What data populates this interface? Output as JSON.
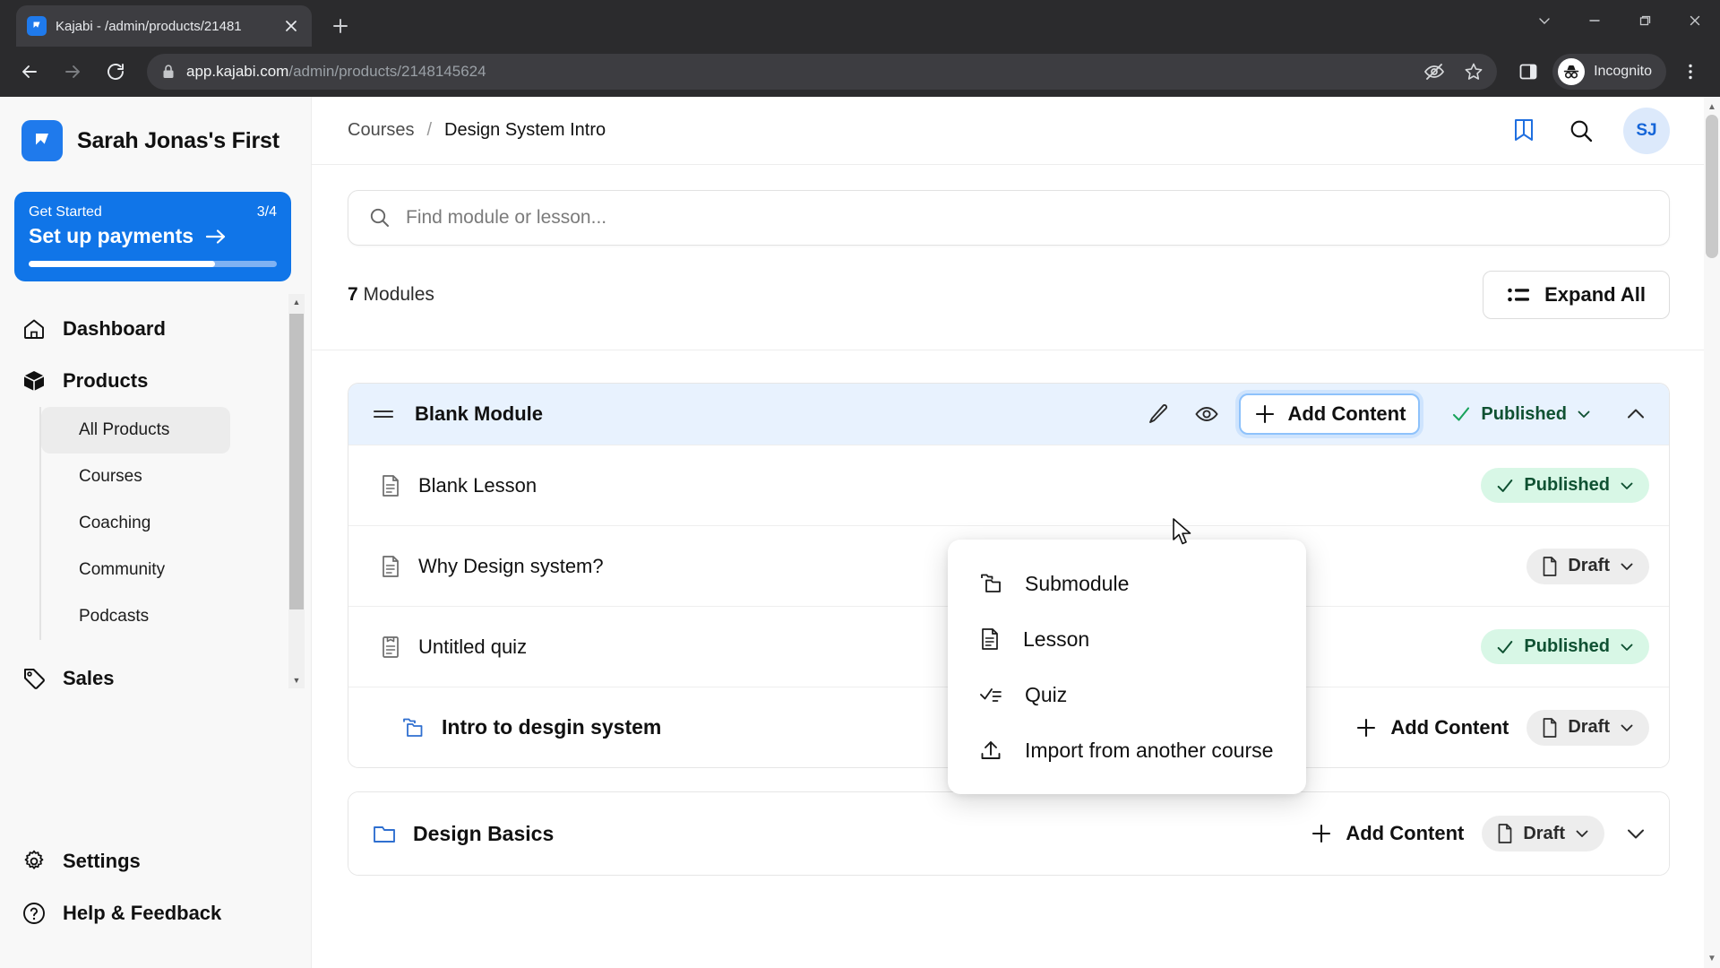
{
  "browser": {
    "tab": {
      "title": "Kajabi - /admin/products/21481",
      "favicon": "kajabi-logo-icon"
    },
    "new_tab_label": "+",
    "url_bold": "app.kajabi.com",
    "url_path": "/admin/products/2148145624",
    "profile_label": "Incognito",
    "window_controls": [
      "minimize-to-tray",
      "minimize",
      "maximize",
      "close"
    ]
  },
  "sidebar": {
    "brand": "Sarah Jonas's First",
    "get_started": {
      "label": "Get Started",
      "progress_label": "3/4",
      "cta": "Set up payments",
      "progress_percent": 75
    },
    "items": [
      {
        "label": "Dashboard",
        "icon": "home-icon"
      },
      {
        "label": "Products",
        "icon": "box-icon"
      },
      {
        "label": "Sales",
        "icon": "tag-icon"
      },
      {
        "label": "Settings",
        "icon": "gear-icon"
      },
      {
        "label": "Help & Feedback",
        "icon": "question-circle-icon"
      }
    ],
    "product_subitems": [
      {
        "label": "All Products",
        "active": true
      },
      {
        "label": "Courses",
        "active": false
      },
      {
        "label": "Coaching",
        "active": false
      },
      {
        "label": "Community",
        "active": false
      },
      {
        "label": "Podcasts",
        "active": false
      }
    ]
  },
  "header": {
    "breadcrumb": {
      "parent": "Courses",
      "separator": "/",
      "current": "Design System Intro"
    },
    "avatar_initials": "SJ"
  },
  "main": {
    "search_placeholder": "Find module or lesson...",
    "module_count_number": "7",
    "module_count_label": "Modules",
    "expand_all_label": "Expand All"
  },
  "module": {
    "title": "Blank Module",
    "add_content_label": "Add Content",
    "status": "Published",
    "rows": [
      {
        "title": "Blank Lesson",
        "icon": "document-icon",
        "status": "Published",
        "status_kind": "published",
        "add_content": false
      },
      {
        "title": "Why Design system?",
        "icon": "document-icon",
        "status": "Draft",
        "status_kind": "draft",
        "add_content": false
      },
      {
        "title": "Untitled quiz",
        "icon": "quiz-document-icon",
        "status": "Published",
        "status_kind": "published",
        "add_content": false
      },
      {
        "title": "Intro to desgin system",
        "icon": "submodule-icon",
        "status": "Draft",
        "status_kind": "draft",
        "add_content": true,
        "add_content_label": "Add Content",
        "submodule": true
      }
    ]
  },
  "module2": {
    "title": "Design Basics",
    "icon": "folder-icon",
    "add_content_label": "Add Content",
    "status": "Draft"
  },
  "menu": {
    "items": [
      {
        "label": "Submodule",
        "icon": "submodule-icon"
      },
      {
        "label": "Lesson",
        "icon": "document-icon"
      },
      {
        "label": "Quiz",
        "icon": "checklist-icon"
      },
      {
        "label": "Import from another course",
        "icon": "upload-icon"
      }
    ]
  },
  "colors": {
    "accent": "#1f7aec",
    "module_header_bg": "#e8f2fe",
    "published_bg": "#d8f7e6",
    "published_text": "#0f5132",
    "draft_bg": "#ededed"
  }
}
